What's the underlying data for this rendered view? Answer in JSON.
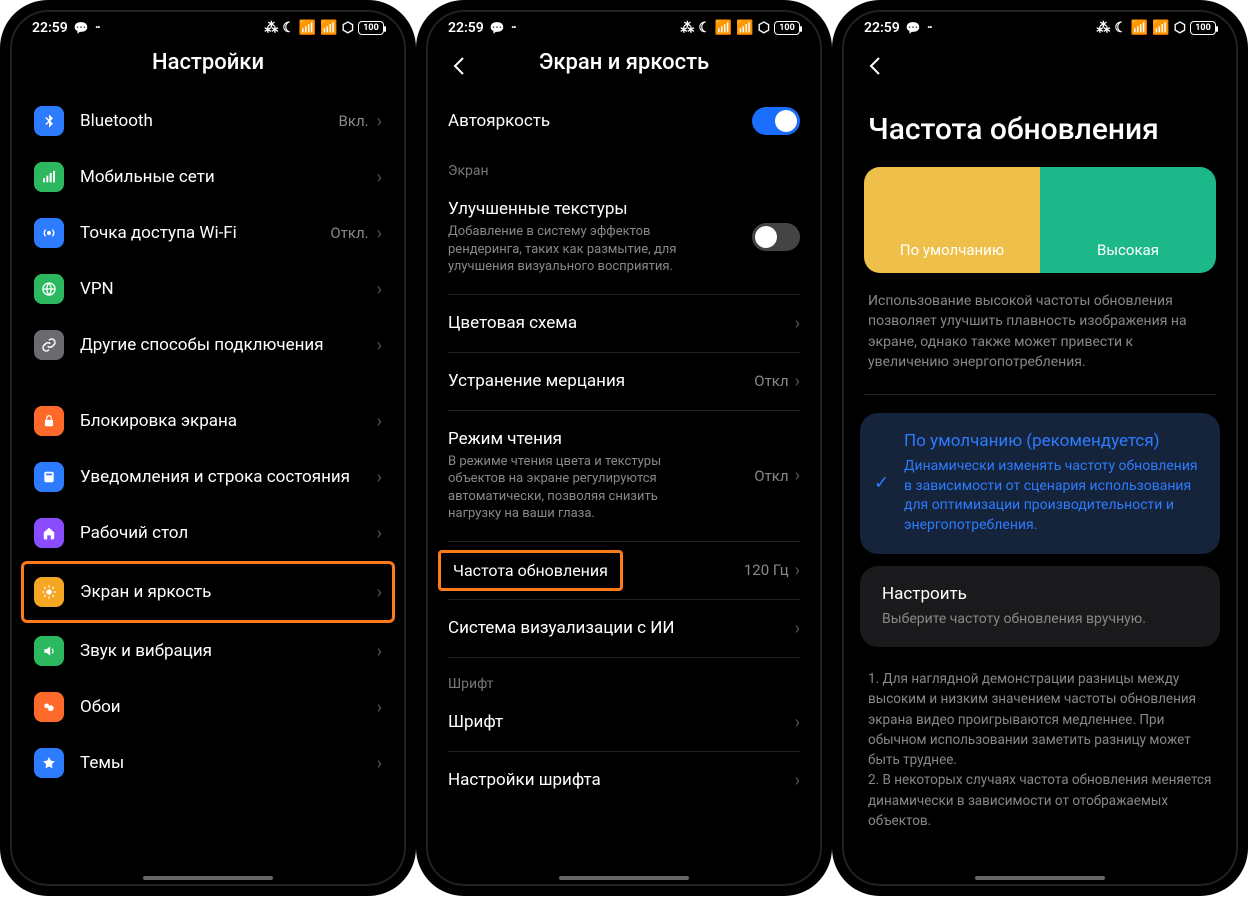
{
  "status": {
    "time": "22:59",
    "battery": "100"
  },
  "phone1": {
    "title": "Настройки",
    "items": [
      {
        "label": "Bluetooth",
        "value": "Вкл.",
        "icon": "bluetooth",
        "color": "#2d7bff"
      },
      {
        "label": "Мобильные сети",
        "value": "",
        "icon": "signal",
        "color": "#2bb85f"
      },
      {
        "label": "Точка доступа Wi-Fi",
        "value": "Откл.",
        "icon": "hotspot",
        "color": "#2d7bff"
      },
      {
        "label": "VPN",
        "value": "",
        "icon": "vpn",
        "color": "#2bb85f"
      },
      {
        "label": "Другие способы подключения",
        "value": "",
        "icon": "link",
        "color": "#6b6b6f"
      }
    ],
    "items2": [
      {
        "label": "Блокировка экрана",
        "icon": "lock",
        "color": "#ff6a2a"
      },
      {
        "label": "Уведомления и строка состояния",
        "icon": "notif",
        "color": "#2d7bff"
      },
      {
        "label": "Рабочий стол",
        "icon": "home",
        "color": "#8a4cff"
      },
      {
        "label": "Экран и яркость",
        "icon": "brightness",
        "color": "#f5a623",
        "highlight": true
      },
      {
        "label": "Звук и вибрация",
        "icon": "sound",
        "color": "#2bb85f"
      },
      {
        "label": "Обои",
        "icon": "wallpaper",
        "color": "#ff6a2a"
      },
      {
        "label": "Темы",
        "icon": "themes",
        "color": "#2d7bff"
      }
    ]
  },
  "phone2": {
    "title": "Экран и яркость",
    "autobright": {
      "label": "Автояркость",
      "on": true
    },
    "group_screen": "Экран",
    "rows": [
      {
        "title": "Улучшенные текстуры",
        "desc": "Добавление в систему эффектов рендеринга, таких как размытие, для улучшения визуального восприятия.",
        "toggle": false
      },
      {
        "title": "Цветовая схема",
        "chev": true
      },
      {
        "title": "Устранение мерцания",
        "value": "Откл",
        "chev": true
      },
      {
        "title": "Режим чтения",
        "desc": "В режиме чтения цвета и текстуры объектов на экране регулируются автоматически, позволяя снизить нагрузку на ваши глаза.",
        "value": "Откл",
        "chev": true
      },
      {
        "title": "Частота обновления",
        "value": "120 Гц",
        "chev": true,
        "highlight": true
      },
      {
        "title": "Система визуализации с ИИ",
        "chev": true
      }
    ],
    "group_font": "Шрифт",
    "font_rows": [
      {
        "title": "Шрифт",
        "chev": true
      },
      {
        "title": "Настройки шрифта",
        "chev": true
      }
    ]
  },
  "phone3": {
    "title": "Частота обновления",
    "seg": {
      "default": "По умолчанию",
      "high": "Высокая"
    },
    "info": "Использование высокой частоты обновления позволяет улучшить плавность изображения на экране, однако также может привести к увеличению энергопотребления.",
    "card_default": {
      "title": "По умолчанию (рекомендуется)",
      "desc": "Динамически изменять частоту обновления в зависимости от сценария использования для оптимизации производительности и энергопотребления."
    },
    "card_custom": {
      "title": "Настроить",
      "desc": "Выберите частоту обновления вручную."
    },
    "notes": "1. Для наглядной демонстрации разницы между высоким и низким значением частоты обновления экрана видео проигрываются медленнее. При обычном использовании заметить разницу может быть труднее.\n2. В некоторых случаях частота обновления меняется динамически в зависимости от отображаемых объектов."
  }
}
